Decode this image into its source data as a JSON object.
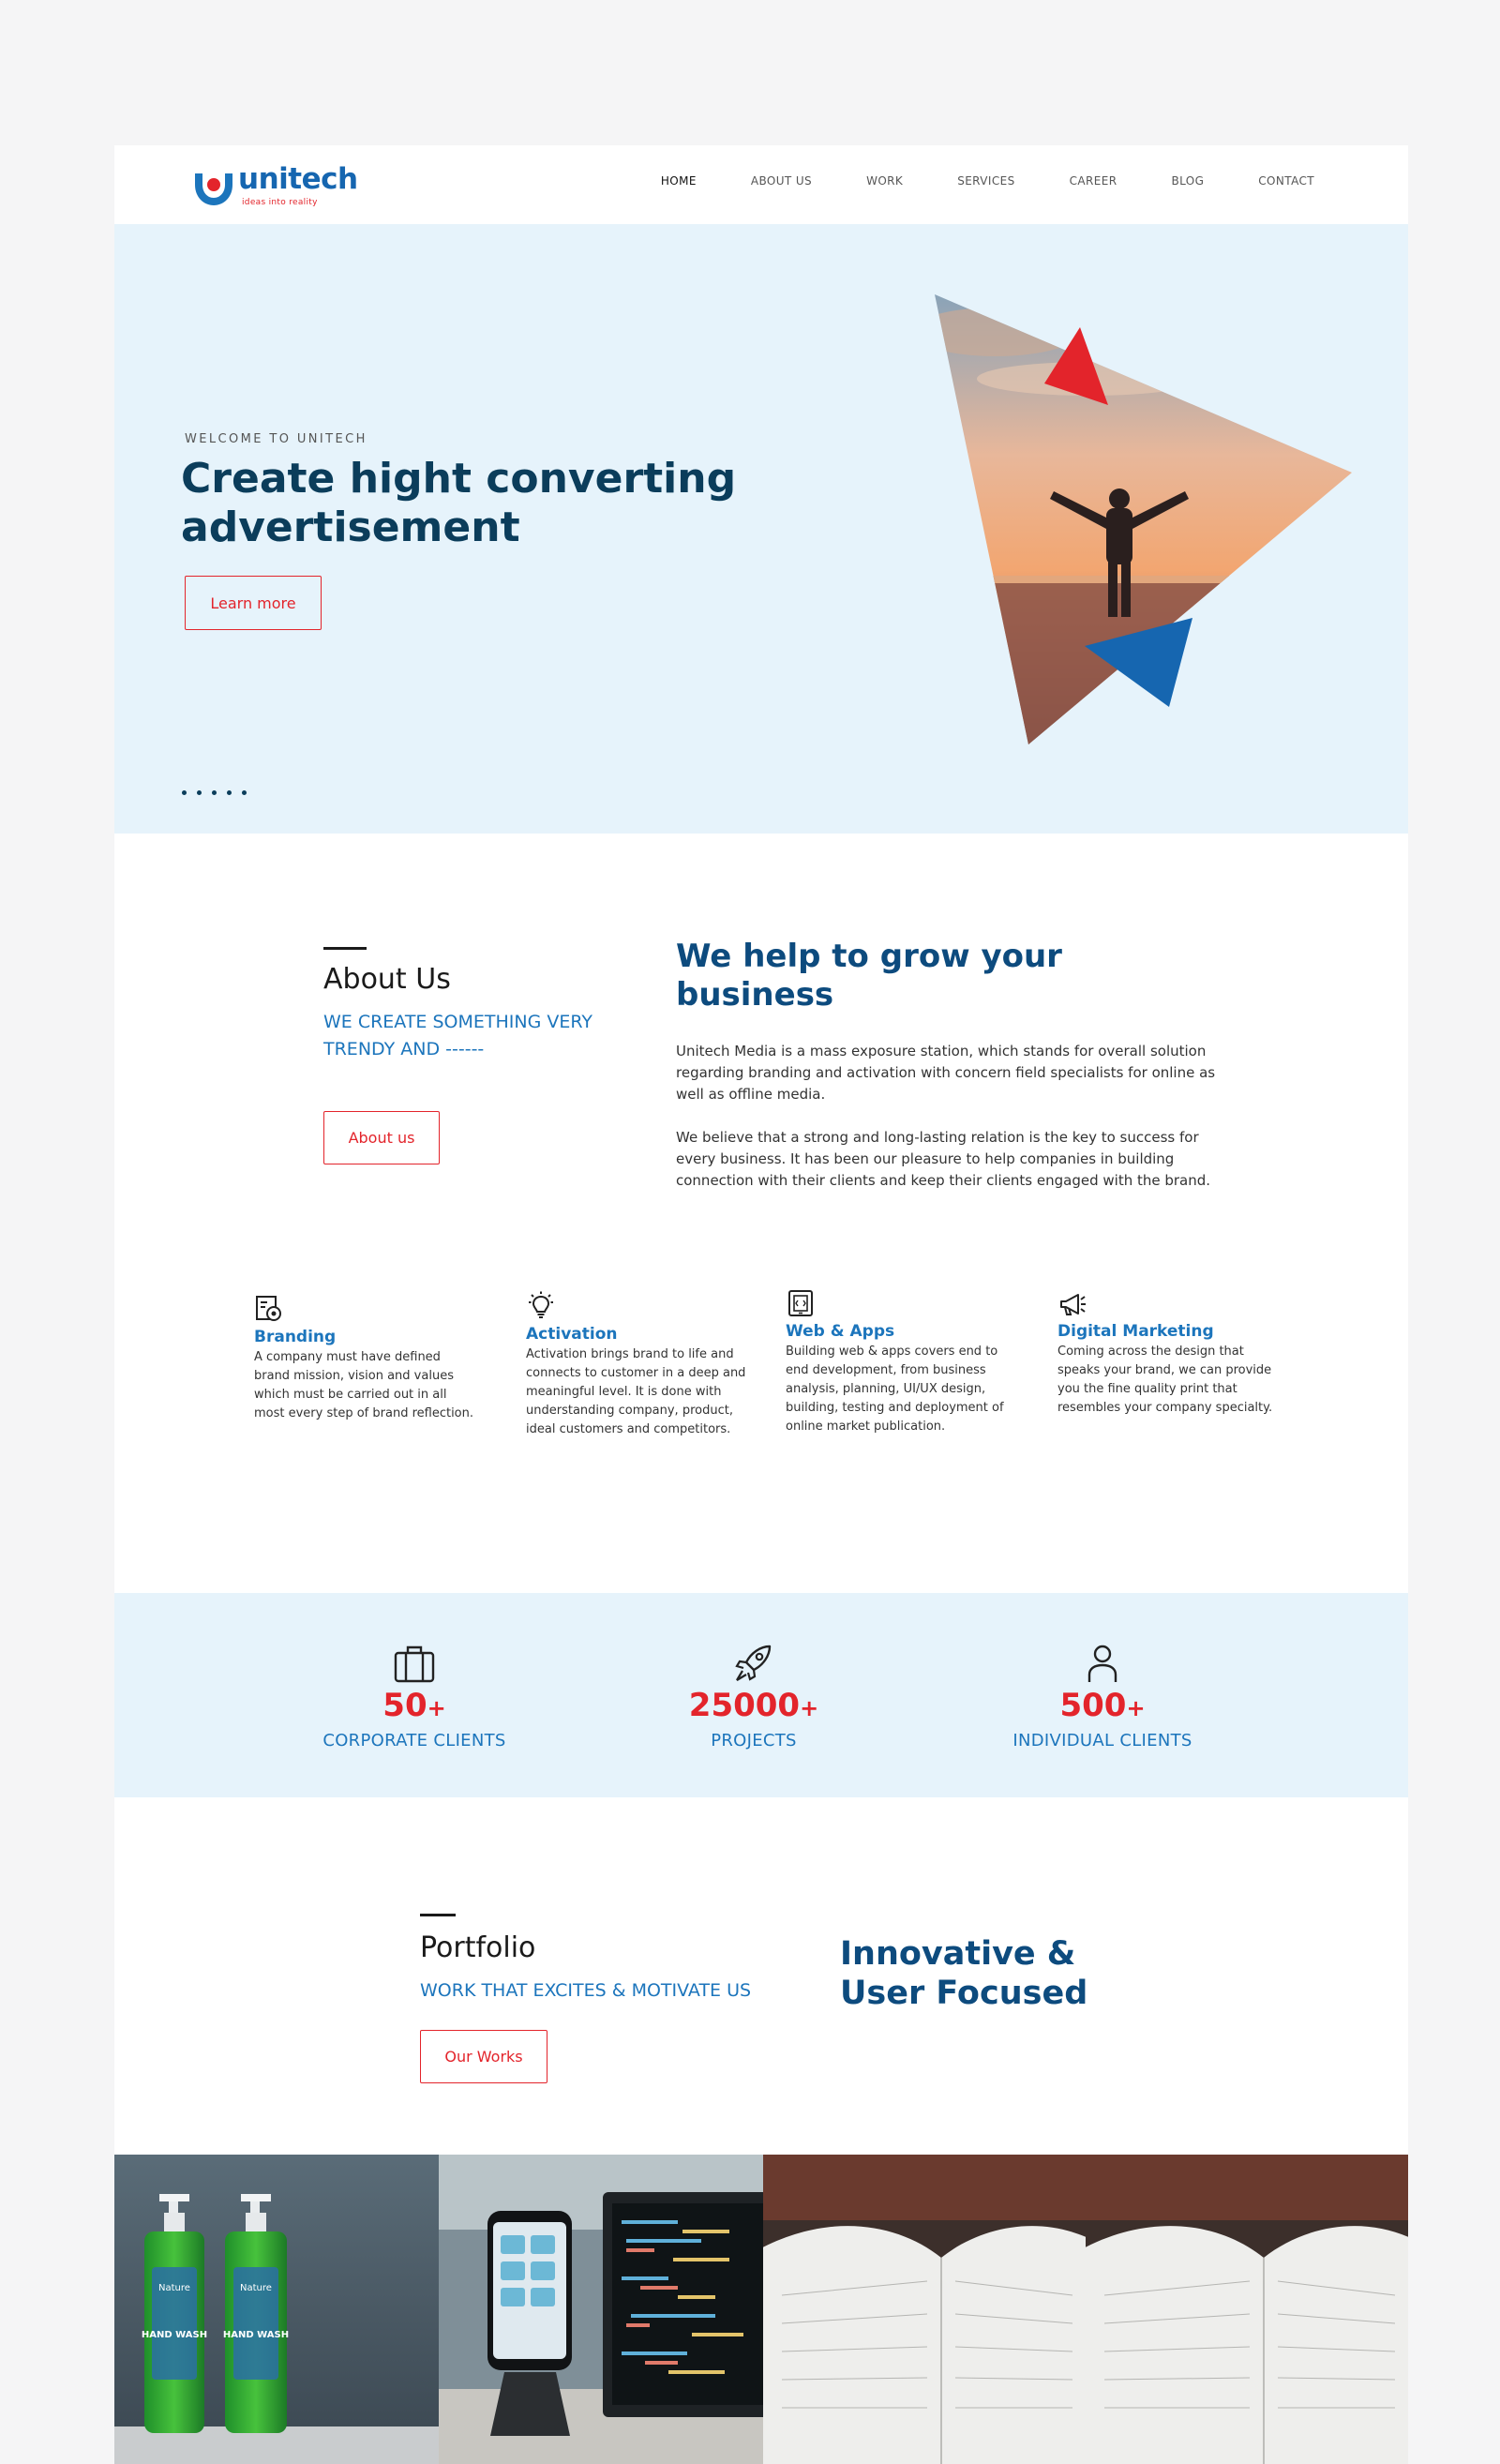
{
  "brand": {
    "name": "unitech",
    "tagline": "ideas into reality",
    "colors": {
      "primary": "#1c75bc",
      "accent": "#e3242b",
      "navy": "#0b3d5b",
      "light_bg": "#e6f3fb"
    }
  },
  "nav": {
    "items": [
      {
        "label": "HOME",
        "active": true
      },
      {
        "label": "ABOUT US",
        "active": false
      },
      {
        "label": "WORK",
        "active": false
      },
      {
        "label": "SERVICES",
        "active": false
      },
      {
        "label": "CAREER",
        "active": false
      },
      {
        "label": "BLOG",
        "active": false
      },
      {
        "label": "CONTACT",
        "active": false
      }
    ]
  },
  "hero": {
    "kicker": "WELCOME TO UNITECH",
    "title": "Create hight converting advertisement",
    "button": "Learn more",
    "slides": 5
  },
  "about": {
    "title": "About Us",
    "subtitle": "WE CREATE SOMETHING VERY TRENDY AND ------",
    "button": "About us",
    "heading": "We help to grow your business",
    "paragraphs": [
      "Unitech Media is a mass exposure station, which stands for overall solution regarding branding and activation with concern field specialists for online as well as offline media.",
      "We believe that a strong and long-lasting relation is the key to success for every business. It has been our pleasure to help companies in building connection with their clients and keep their clients engaged with the brand."
    ]
  },
  "services": [
    {
      "icon": "branding-icon",
      "title": "Branding",
      "desc": "A company must have defined brand mission, vision and values which must be carried out in all most every step of brand reflection."
    },
    {
      "icon": "lightbulb-icon",
      "title": "Activation",
      "desc": "Activation brings brand to life and connects to customer in a deep and meaningful level. It is done with understanding company, product, ideal customers and competitors."
    },
    {
      "icon": "tablet-icon",
      "title": "Web & Apps",
      "desc": "Building web & apps covers end to end development, from business analysis, planning, UI/UX design, building, testing and deployment of online market publication."
    },
    {
      "icon": "megaphone-icon",
      "title": "Digital Marketing",
      "desc": "Coming across the design that speaks your brand, we can provide you the fine quality print that resembles your company specialty."
    }
  ],
  "stats": [
    {
      "icon": "briefcase-icon",
      "value": "50",
      "suffix": "+",
      "label": "CORPORATE CLIENTS"
    },
    {
      "icon": "rocket-icon",
      "value": "25000",
      "suffix": "+",
      "label": "PROJECTS"
    },
    {
      "icon": "person-icon",
      "value": "500",
      "suffix": "+",
      "label": "INDIVIDUAL CLIENTS"
    }
  ],
  "portfolio": {
    "title": "Portfolio",
    "subtitle": "WORK THAT EXCITES & MOTIVATE US",
    "button": "Our Works",
    "heading": "Innovative & User Focused",
    "items": [
      {
        "name": "hand-wash-bottles-photo",
        "label_a": "Nature",
        "label_b": "HAND WASH"
      },
      {
        "name": "phone-and-laptop-photo"
      },
      {
        "name": "open-planner-photo"
      },
      {
        "name": "open-planner-photo-2"
      }
    ]
  }
}
